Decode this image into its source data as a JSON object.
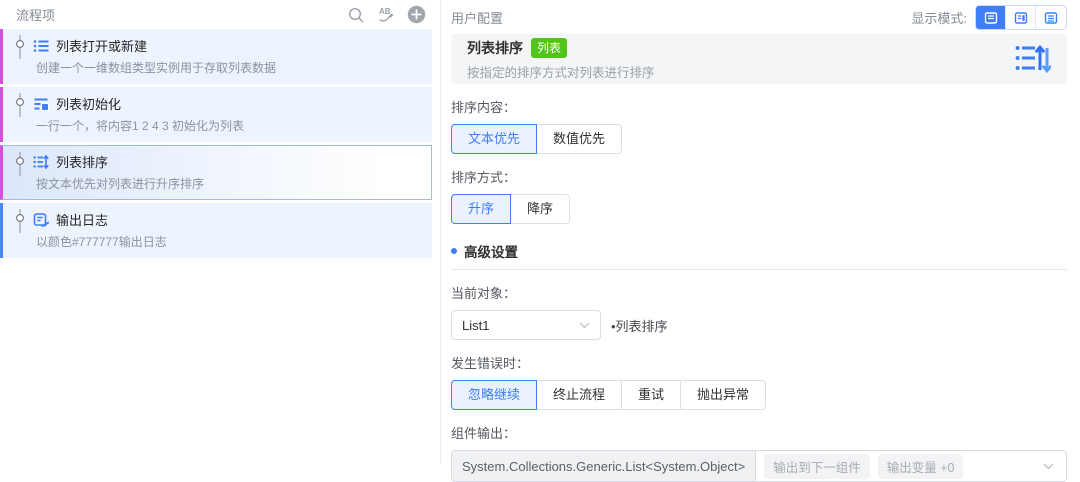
{
  "left_panel": {
    "title": "流程项",
    "items": [
      {
        "title": "列表打开或新建",
        "desc": "创建一个一维数组类型实例用于存取列表数据",
        "icon": "list-icon",
        "accent_color": "#d94fd9",
        "selected": false
      },
      {
        "title": "列表初始化",
        "desc": "一行一个，将内容1 2 4 3 初始化为列表",
        "icon": "list-init-icon",
        "accent_color": "#d94fd9",
        "selected": false
      },
      {
        "title": "列表排序",
        "desc": "按文本优先对列表进行升序排序",
        "icon": "list-sort-icon",
        "accent_color": "#d94fd9",
        "selected": true
      },
      {
        "title": "输出日志",
        "desc": "以颜色#777777输出日志",
        "icon": "log-icon",
        "accent_color": "#4b87f8",
        "selected": false
      }
    ]
  },
  "right_panel": {
    "title": "用户配置",
    "display_mode": {
      "label": "显示模式:",
      "active_color": "#3e7ef7",
      "modes": [
        "card-view",
        "split-view",
        "list-view"
      ],
      "active_index": 0
    },
    "card": {
      "title": "列表排序",
      "badge": "列表",
      "badge_color": "#52c41a",
      "desc": "按指定的排序方式对列表进行排序",
      "icon": "list-sort-large-icon"
    },
    "sort_content": {
      "label": "排序内容：",
      "options": [
        "文本优先",
        "数值优先"
      ],
      "selected_index": 0
    },
    "sort_method": {
      "label": "排序方式：",
      "options": [
        "升序",
        "降序"
      ],
      "selected_index": 0
    },
    "advanced": {
      "label": "高级设置"
    },
    "current_object": {
      "label": "当前对象：",
      "value": "List1",
      "note": "•列表排序"
    },
    "on_error": {
      "label": "发生错误时：",
      "options": [
        "忽略继续",
        "终止流程",
        "重试",
        "抛出异常"
      ],
      "selected_index": 0
    },
    "output": {
      "label": "组件输出：",
      "type_tag": "System.Collections.Generic.List<System.Object>",
      "chips": [
        "输出到下一组件",
        "输出变量 +0"
      ]
    }
  }
}
